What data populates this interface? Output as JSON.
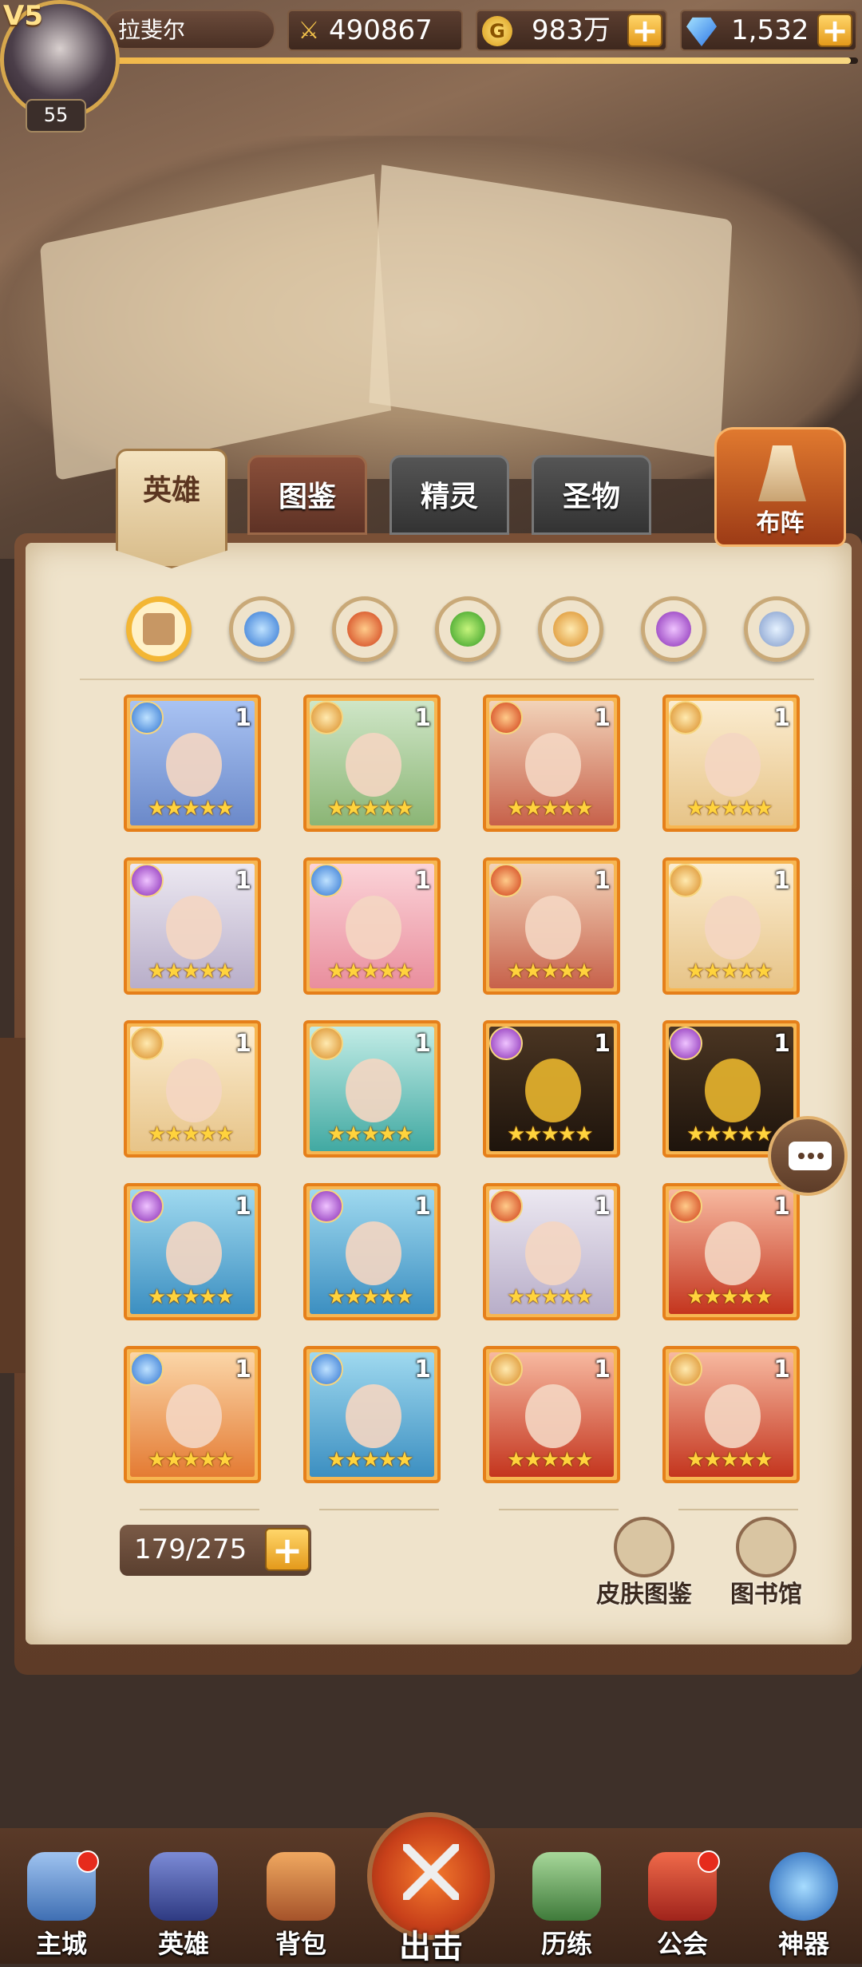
{
  "player": {
    "vip": "V5",
    "level": "55",
    "name": "拉斐尔"
  },
  "resources": {
    "power": "490867",
    "gold": "983万",
    "gems": "1,532",
    "gold_icon": "G"
  },
  "tabs": [
    {
      "label": "英雄",
      "active": true
    },
    {
      "label": "图鉴",
      "active": false
    },
    {
      "label": "精灵",
      "active": false
    },
    {
      "label": "圣物",
      "active": false
    }
  ],
  "formation_label": "布阵",
  "filters": [
    "all",
    "water",
    "fire",
    "wind",
    "light",
    "dark",
    "void"
  ],
  "heroes": [
    {
      "element": "water",
      "level": "1",
      "stars": "★★★★★",
      "art": "art-blue"
    },
    {
      "element": "light",
      "level": "1",
      "stars": "★★★★★",
      "art": "art-green"
    },
    {
      "element": "fire",
      "level": "1",
      "stars": "★★★★★",
      "art": "art-red"
    },
    {
      "element": "light",
      "level": "1",
      "stars": "★★★★★",
      "art": "art-gold"
    },
    {
      "element": "dark",
      "level": "1",
      "stars": "★★★★★",
      "art": "art-white"
    },
    {
      "element": "water",
      "level": "1",
      "stars": "★★★★★",
      "art": "art-pink"
    },
    {
      "element": "fire",
      "level": "1",
      "stars": "★★★★★",
      "art": "art-red"
    },
    {
      "element": "light",
      "level": "1",
      "stars": "★★★★★",
      "art": "art-gold"
    },
    {
      "element": "light",
      "level": "1",
      "stars": "★★★★★",
      "art": "art-gold"
    },
    {
      "element": "light",
      "level": "1",
      "stars": "★★★★★",
      "art": "art-teal"
    },
    {
      "element": "dark",
      "level": "1",
      "stars": "★★★★★",
      "art": "art-anubis"
    },
    {
      "element": "dark",
      "level": "1",
      "stars": "★★★★★",
      "art": "art-anubis"
    },
    {
      "element": "dark",
      "level": "1",
      "stars": "★★★★★",
      "art": "art-aqua"
    },
    {
      "element": "dark",
      "level": "1",
      "stars": "★★★★★",
      "art": "art-aqua"
    },
    {
      "element": "fire",
      "level": "1",
      "stars": "★★★★★",
      "art": "art-white"
    },
    {
      "element": "fire",
      "level": "1",
      "stars": "★★★★★",
      "art": "art-crimson"
    },
    {
      "element": "water",
      "level": "1",
      "stars": "★★★★★",
      "art": "art-orange"
    },
    {
      "element": "water",
      "level": "1",
      "stars": "★★★★★",
      "art": "art-aqua"
    },
    {
      "element": "light",
      "level": "1",
      "stars": "★★★★★",
      "art": "art-crimson"
    },
    {
      "element": "light",
      "level": "1",
      "stars": "★★★★★",
      "art": "art-crimson"
    }
  ],
  "capacity": "179/275",
  "tools": {
    "skins": "皮肤图鉴",
    "library": "图书馆"
  },
  "nav": {
    "city": "主城",
    "heroes": "英雄",
    "bag": "背包",
    "battle": "出击",
    "training": "历练",
    "guild": "公会",
    "artifact": "神器"
  },
  "colors": {
    "accent": "#e57f1a",
    "panel": "#efe3cb",
    "star": "#ffd33d"
  }
}
